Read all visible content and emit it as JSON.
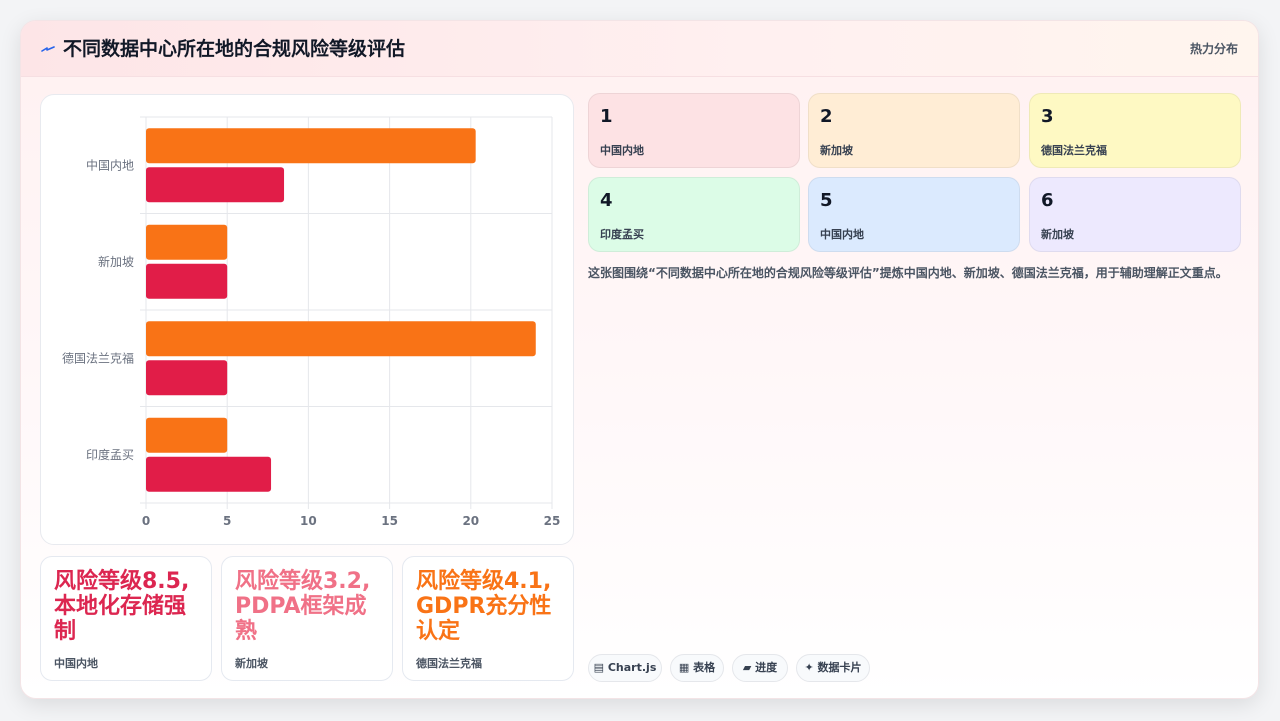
{
  "header": {
    "icon": "bolt-icon",
    "title": "不同数据中心所在地的合规风险等级评估",
    "tag": "热力分布"
  },
  "chart_data": {
    "type": "bar",
    "orientation": "horizontal",
    "categories": [
      "中国内地",
      "新加坡",
      "德国法兰克福",
      "印度孟买"
    ],
    "series": [
      {
        "values": [
          20.3,
          5,
          24,
          5
        ],
        "color": "#f97316"
      },
      {
        "values": [
          8.5,
          5,
          5,
          7.7
        ],
        "color": "#e11d48"
      }
    ],
    "xlim": [
      0,
      25
    ],
    "x_ticks": [
      "0",
      "5",
      "10",
      "15",
      "20",
      "25"
    ],
    "grid": true,
    "legend": "none"
  },
  "stats": [
    {
      "text": "风险等级8.5, 本地化存储强制",
      "caption": "中国内地",
      "color": "#dc2650"
    },
    {
      "text": "风险等级3.2, PDPA框架成熟",
      "caption": "新加坡",
      "color": "#f07187"
    },
    {
      "text": "风险等级4.1, GDPR充分性认定",
      "caption": "德国法兰克福",
      "color": "#f97316"
    }
  ],
  "tiles": [
    {
      "num": "1",
      "label": "中国内地",
      "bg": "#fde2e4"
    },
    {
      "num": "2",
      "label": "新加坡",
      "bg": "#ffedd5"
    },
    {
      "num": "3",
      "label": "德国法兰克福",
      "bg": "#fef9c3"
    },
    {
      "num": "4",
      "label": "印度孟买",
      "bg": "#dcfce7"
    },
    {
      "num": "5",
      "label": "中国内地",
      "bg": "#dbeafe"
    },
    {
      "num": "6",
      "label": "新加坡",
      "bg": "#ede9fe"
    }
  ],
  "description": "这张图围绕“不同数据中心所在地的合规风险等级评估”提炼中国内地、新加坡、德国法兰克福，用于辅助理解正文重点。",
  "chips": [
    {
      "icon": "▤",
      "label": "Chart.js"
    },
    {
      "icon": "▦",
      "label": "表格"
    },
    {
      "icon": "▰",
      "label": "进度"
    },
    {
      "icon": "✦",
      "label": "数据卡片"
    }
  ]
}
